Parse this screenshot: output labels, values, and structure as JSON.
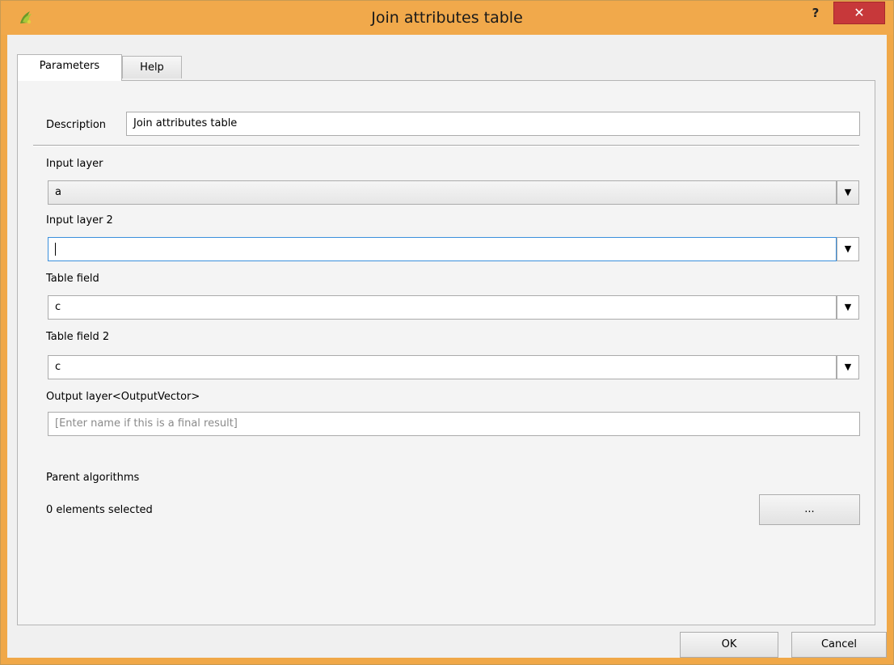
{
  "window": {
    "title": "Join attributes table",
    "help_glyph": "?",
    "close_glyph": "✕"
  },
  "tabs": [
    {
      "label": "Parameters",
      "active": true
    },
    {
      "label": "Help",
      "active": false
    }
  ],
  "form": {
    "description": {
      "label": "Description",
      "value": "Join attributes table"
    },
    "input_layer": {
      "label": "Input layer",
      "value": "a"
    },
    "input_layer_2": {
      "label": "Input layer 2",
      "value": ""
    },
    "table_field": {
      "label": "Table field",
      "value": "c"
    },
    "table_field_2": {
      "label": "Table field 2",
      "value": "c"
    },
    "output_layer": {
      "label": "Output layer<OutputVector>",
      "placeholder": "[Enter name if this is a final result]"
    },
    "parent_algorithms": {
      "label": "Parent algorithms",
      "status": "0 elements selected",
      "button_label": "..."
    }
  },
  "buttons": {
    "ok": "OK",
    "cancel": "Cancel"
  },
  "icons": {
    "app": "qgis-icon",
    "dropdown": "▼"
  },
  "colors": {
    "titlebar": "#f1a94b",
    "close_button": "#c7383a",
    "focus_border": "#3a8fdc"
  }
}
